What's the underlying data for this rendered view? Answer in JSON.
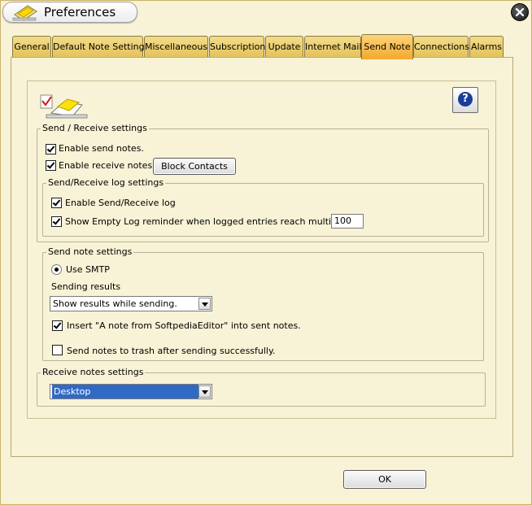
{
  "window": {
    "title": "Preferences"
  },
  "tabs": [
    {
      "label": "General"
    },
    {
      "label": "Default Note Settings"
    },
    {
      "label": "Miscellaneous"
    },
    {
      "label": "Subscription"
    },
    {
      "label": "Update"
    },
    {
      "label": "Internet Mail"
    },
    {
      "label": "Send Note",
      "active": true
    },
    {
      "label": "Connections"
    },
    {
      "label": "Alarms"
    }
  ],
  "send_receive": {
    "legend": "Send / Receive settings",
    "enable_send": {
      "label": "Enable send notes.",
      "checked": true
    },
    "enable_receive": {
      "label": "Enable receive notes.",
      "checked": true
    },
    "block_contacts_label": "Block Contacts"
  },
  "log_settings": {
    "legend": "Send/Receive log settings",
    "enable_log": {
      "label": "Enable Send/Receive log",
      "checked": true
    },
    "empty_log": {
      "label": "Show Empty Log reminder when logged entries reach multiples of",
      "checked": true
    },
    "multiple_value": "100"
  },
  "send_note_settings": {
    "legend": "Send note settings",
    "use_smtp": {
      "label": "Use SMTP",
      "selected": true
    },
    "sending_results_label": "Sending results",
    "sending_results_value": "Show results while sending.",
    "insert_note": {
      "label": "Insert \"A note from SoftpediaEditor\" into sent notes.",
      "checked": true
    },
    "trash_notes": {
      "label": "Send notes to trash after sending successfully.",
      "checked": false
    }
  },
  "receive_settings": {
    "legend": "Receive notes settings",
    "location_value": "Desktop"
  },
  "ok_label": "OK",
  "colors": {
    "active_tab": "#f2a92e",
    "tab": "#e2c25a",
    "background": "#f8f2d6",
    "selection": "#316ac5"
  },
  "icons": [
    "app-note-icon",
    "close-icon",
    "help-icon",
    "send-note-icon"
  ]
}
